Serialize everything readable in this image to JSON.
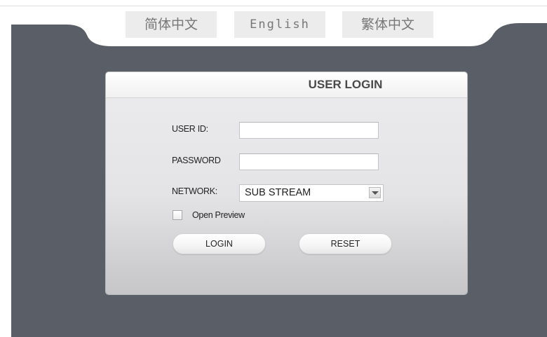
{
  "languages": {
    "simplified_chinese": "简体中文",
    "english": "English",
    "traditional_chinese": "繁体中文"
  },
  "login": {
    "title": "USER LOGIN",
    "user_id_label": "USER ID:",
    "user_id_value": "",
    "password_label": "PASSWORD",
    "password_value": "",
    "network_label": "NETWORK:",
    "network_selected": "SUB STREAM",
    "open_preview_label": "Open Preview",
    "open_preview_checked": false,
    "login_button": "LOGIN",
    "reset_button": "RESET"
  },
  "colors": {
    "background_dark": "#5a5e67",
    "panel_light": "#e4e4e6"
  }
}
